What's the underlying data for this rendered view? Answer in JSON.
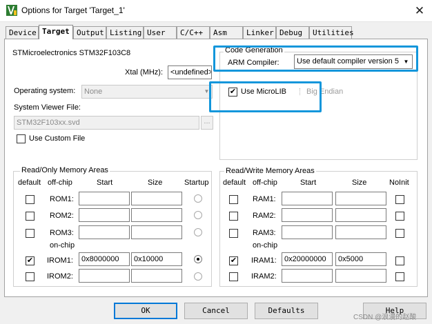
{
  "window": {
    "title": "Options for Target 'Target_1'",
    "close_glyph": "✕"
  },
  "tabs": [
    "Device",
    "Target",
    "Output",
    "Listing",
    "User",
    "C/C++",
    "Asm",
    "Linker",
    "Debug",
    "Utilities"
  ],
  "active_tab": "Target",
  "device_name": "STMicroelectronics STM32F103C8",
  "xtal": {
    "label": "Xtal (MHz):",
    "value": "<undefined>"
  },
  "os": {
    "label": "Operating system:",
    "value": "None"
  },
  "svd": {
    "label": "System Viewer File:",
    "value": "STM32F103xx.svd",
    "browse": "..."
  },
  "custom_file": {
    "label": "Use Custom File",
    "checked": false
  },
  "codegen": {
    "legend": "Code Generation",
    "compiler_label": "ARM Compiler:",
    "compiler_value": "Use default compiler version 5",
    "microlib": {
      "label": "Use MicroLIB",
      "checked": true
    },
    "big_endian": {
      "label": "Big Endian",
      "checked": false
    }
  },
  "ro_memory": {
    "legend": "Read/Only Memory Areas",
    "headers": {
      "default": "default",
      "offchip": "off-chip",
      "start": "Start",
      "size": "Size",
      "last": "Startup"
    },
    "onchip_label": "on-chip",
    "rows": [
      {
        "name": "ROM1:",
        "start": "",
        "size": "",
        "default": false,
        "startup": false
      },
      {
        "name": "ROM2:",
        "start": "",
        "size": "",
        "default": false,
        "startup": false
      },
      {
        "name": "ROM3:",
        "start": "",
        "size": "",
        "default": false,
        "startup": false
      },
      {
        "name": "IROM1:",
        "start": "0x8000000",
        "size": "0x10000",
        "default": true,
        "startup": true
      },
      {
        "name": "IROM2:",
        "start": "",
        "size": "",
        "default": false,
        "startup": false
      }
    ]
  },
  "rw_memory": {
    "legend": "Read/Write Memory Areas",
    "headers": {
      "default": "default",
      "offchip": "off-chip",
      "start": "Start",
      "size": "Size",
      "last": "NoInit"
    },
    "onchip_label": "on-chip",
    "rows": [
      {
        "name": "RAM1:",
        "start": "",
        "size": "",
        "default": false,
        "noinit": false
      },
      {
        "name": "RAM2:",
        "start": "",
        "size": "",
        "default": false,
        "noinit": false
      },
      {
        "name": "RAM3:",
        "start": "",
        "size": "",
        "default": false,
        "noinit": false
      },
      {
        "name": "IRAM1:",
        "start": "0x20000000",
        "size": "0x5000",
        "default": true,
        "noinit": false
      },
      {
        "name": "IRAM2:",
        "start": "",
        "size": "",
        "default": false,
        "noinit": false
      }
    ]
  },
  "buttons": {
    "ok": "OK",
    "cancel": "Cancel",
    "defaults": "Defaults",
    "help": "Help"
  },
  "watermark": "CSDN @浪漫的赵酸",
  "colors": {
    "highlight": "#1296db",
    "window_bg": "#f0f0f0",
    "panel_bg": "#ffffff"
  }
}
